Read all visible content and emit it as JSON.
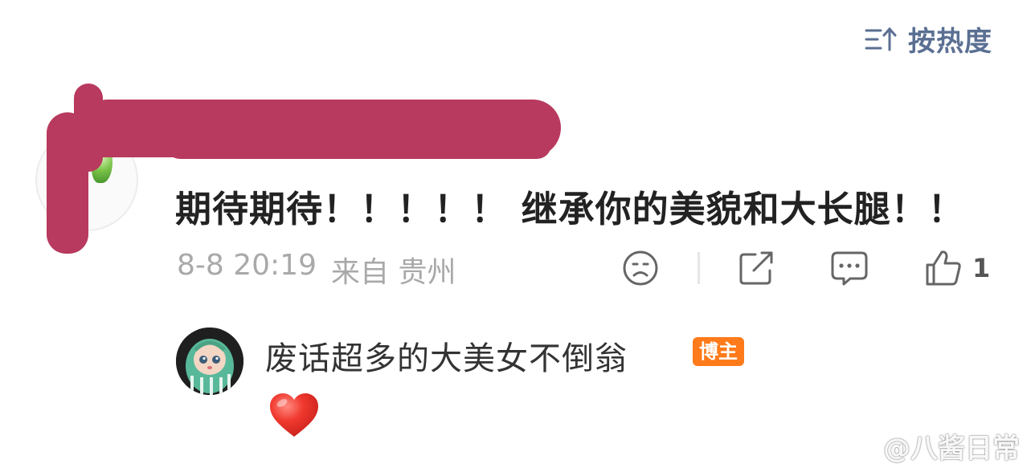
{
  "sort": {
    "label": "按热度",
    "icon": "sort-icon"
  },
  "comment": {
    "text": "期待期待！！！！！ 继承你的美貌和大长腿！！",
    "date": "8-8 20:19",
    "location": "来自 贵州",
    "like_count": "1"
  },
  "reply": {
    "username": "废话超多的大美女不倒翁",
    "badge": "博主",
    "content_icon": "heart-emoji"
  },
  "watermark": {
    "text": "@八酱日常"
  },
  "colors": {
    "redaction": "#b83a5e",
    "sort_text": "#5a6f92",
    "badge": "#ff7a1a",
    "heart": "#e8302a"
  }
}
